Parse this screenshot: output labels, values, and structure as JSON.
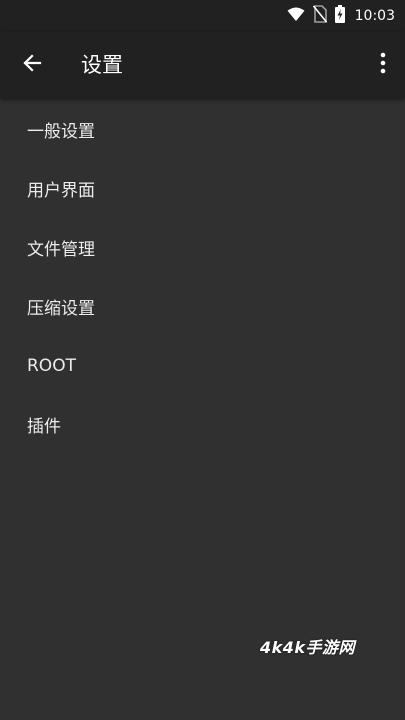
{
  "status_bar": {
    "time": "10:03",
    "icons": [
      "wifi-icon",
      "no-sim-icon",
      "battery-charging-icon"
    ]
  },
  "app_bar": {
    "title": "设置",
    "back_icon": "arrow-left-icon",
    "menu_icon": "more-vertical-icon"
  },
  "menu": {
    "items": [
      {
        "label": "一般设置"
      },
      {
        "label": "用户界面"
      },
      {
        "label": "文件管理"
      },
      {
        "label": "压缩设置"
      },
      {
        "label": "ROOT"
      },
      {
        "label": "插件"
      }
    ]
  },
  "watermark": {
    "text": "4k4k手游网"
  },
  "colors": {
    "background": "#303030",
    "app_bar": "#212121",
    "text": "#ececec"
  }
}
